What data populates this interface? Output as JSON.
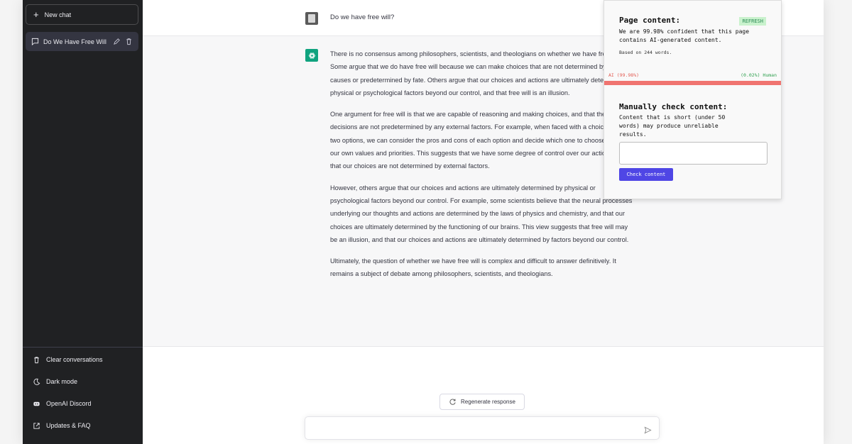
{
  "sidebar": {
    "new_chat_label": "New chat",
    "conversations": [
      {
        "label": "Do We Have Free Will"
      }
    ],
    "bottom_links": [
      {
        "label": "Clear conversations",
        "icon": "trash-icon"
      },
      {
        "label": "Dark mode",
        "icon": "moon-icon"
      },
      {
        "label": "OpenAI Discord",
        "icon": "discord-icon"
      },
      {
        "label": "Updates & FAQ",
        "icon": "external-link-icon"
      }
    ]
  },
  "chat": {
    "user_message": "Do we have free will?",
    "assistant_paragraphs": [
      "There is no consensus among philosophers, scientists, and theologians on whether we have free will. Some argue that we do have free will because we can make choices that are not determined by prior causes or predetermined by fate. Others argue that our choices and actions are ultimately determined by physical or psychological factors beyond our control, and that free will is an illusion.",
      "One argument for free will is that we are capable of reasoning and making choices, and that these decisions are not predetermined by any external factors. For example, when faced with a choice between two options, we can consider the pros and cons of each option and decide which one to choose based on our own values and priorities. This suggests that we have some degree of control over our actions and that our choices are not determined by external factors.",
      "However, others argue that our choices and actions are ultimately determined by physical or psychological factors beyond our control. For example, some scientists believe that the neural processes underlying our thoughts and actions are determined by the laws of physics and chemistry, and that our choices are ultimately determined by the functioning of our brains. This view suggests that free will may be an illusion, and that our choices and actions are ultimately determined by factors beyond our control.",
      "Ultimately, the question of whether we have free will is complex and difficult to answer definitively. It remains a subject of debate among philosophers, scientists, and theologians."
    ],
    "regenerate_label": "Regenerate response",
    "input_placeholder": ""
  },
  "popup": {
    "title": "Page content:",
    "refresh_label": "REFRESH",
    "confidence_text": "We are 99.98% confident that this page contains AI-generated content.",
    "based_on": "Based on 244 words.",
    "ai_label": "AI (99.98%)",
    "human_label": "(0.02%) Human",
    "ai_fraction": 0.9998,
    "manual_title": "Manually check content:",
    "manual_note": "Content that is short (under 50 words) may produce unreliable results.",
    "check_button": "Check content"
  },
  "colors": {
    "sidebar_bg": "#202123",
    "assistant_bg": "#f7f7f8",
    "gpt_green": "#10a37f",
    "ai_red": "#f07470",
    "human_green": "#2ea04f",
    "button_indigo": "#4f46e5"
  }
}
